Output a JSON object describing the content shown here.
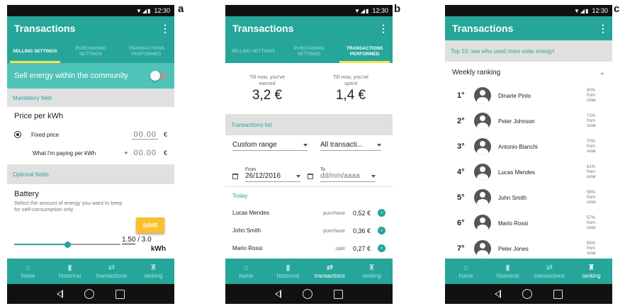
{
  "panel_labels": [
    "a",
    "b",
    "c"
  ],
  "status_time": "12:30",
  "app_title": "Transactions",
  "tabs": [
    "SELLING SETTINGS",
    "PURCHASING SETTINGS",
    "TRANSACTIONS PERFORMED"
  ],
  "nav": [
    {
      "label": "home",
      "icon": "home-icon"
    },
    {
      "label": "historical",
      "icon": "bar-chart-icon"
    },
    {
      "label": "transactions",
      "icon": "swap-arrows-icon"
    },
    {
      "label": "ranking",
      "icon": "trophy-icon"
    }
  ],
  "panel_a": {
    "sell_label": "Sell energy within the community",
    "mandatory_header": "Mandatory field",
    "price_title": "Price per kWh",
    "fixed_price_label": "Fixed price",
    "fixed_price_value": "00.00",
    "currency": "€",
    "paying_label": "What I'm paying per kWh",
    "paying_sign": "+",
    "paying_value": "00.00",
    "optional_header": "Optional fields",
    "battery_title": "Battery",
    "battery_desc": "Select the amount of energy you want to keep for self-consumption only",
    "slider_value": "1.50",
    "slider_max": "/ 3.0",
    "slider_unit": "kWh",
    "slider_fraction": 0.5,
    "save_label": "SAVE"
  },
  "panel_b": {
    "earned_caption": "Till now, you've earned",
    "earned_value": "3,2 €",
    "spent_caption": "Till now, you've spent",
    "spent_value": "1,4 €",
    "list_header": "Transactions list",
    "range_dropdown": "Custom range",
    "type_dropdown": "All transacti...",
    "from_label": "From",
    "from_value": "26/12/2016",
    "to_label": "To",
    "to_placeholder": "dd/mm/aaaa",
    "today_label": "Today",
    "transactions": [
      {
        "name": "Lucas Mendes",
        "type": "purchase",
        "amount": "0,52 €"
      },
      {
        "name": "John Smith",
        "type": "purchase",
        "amount": "0,36 €"
      },
      {
        "name": "Mario Rossi",
        "type": "sale",
        "amount": "0,27 €"
      }
    ]
  },
  "panel_c": {
    "banner": "Top 10: see who used more solar energy!",
    "weekly_label": "Weekly ranking",
    "rankings": [
      {
        "rank": "1°",
        "name": "Dinarte Pinto",
        "pct": "80%",
        "l1": "from",
        "l2": "solar"
      },
      {
        "rank": "2°",
        "name": "Peter Johnson",
        "pct": "72%",
        "l1": "from",
        "l2": "solar"
      },
      {
        "rank": "3°",
        "name": "Antonio Bianchi",
        "pct": "70%",
        "l1": "from",
        "l2": "solar"
      },
      {
        "rank": "4°",
        "name": "Lucas Mendes",
        "pct": "61%",
        "l1": "from",
        "l2": "solar"
      },
      {
        "rank": "5°",
        "name": "John Smith",
        "pct": "59%",
        "l1": "from",
        "l2": "solar"
      },
      {
        "rank": "6°",
        "name": "Mario Rossi",
        "pct": "57%",
        "l1": "from",
        "l2": "solar"
      },
      {
        "rank": "7°",
        "name": "Peter Jones",
        "pct": "55%",
        "l1": "from",
        "l2": "solar"
      }
    ]
  }
}
